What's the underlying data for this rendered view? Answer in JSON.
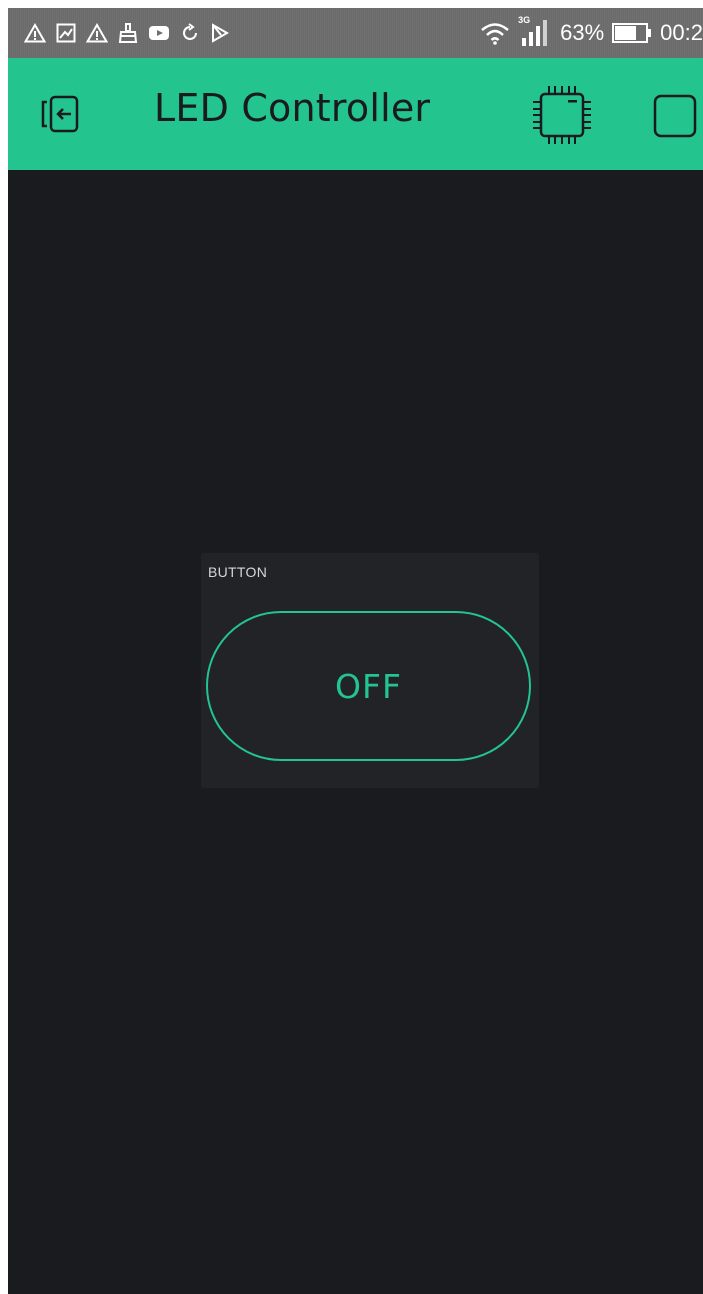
{
  "status_bar": {
    "network_type": "3G",
    "battery_percent": "63%",
    "time": "00:2",
    "notification_icons": [
      "warning-icon",
      "image-icon",
      "warning-icon",
      "cleaner-icon",
      "youtube-icon",
      "sync-icon",
      "play-store-icon"
    ],
    "system_icons": [
      "wifi-icon",
      "signal-icon",
      "battery-icon"
    ]
  },
  "app_bar": {
    "title": "LED Controller",
    "background_color": "#23c48e",
    "icons": [
      "back-exit-icon",
      "device-chip-icon",
      "square-icon"
    ]
  },
  "widget": {
    "label": "BUTTON",
    "button_text": "OFF",
    "accent_color": "#23c48e"
  },
  "colors": {
    "canvas_background": "#1a1b1f",
    "widget_background": "#222327",
    "accent": "#23c48e"
  }
}
